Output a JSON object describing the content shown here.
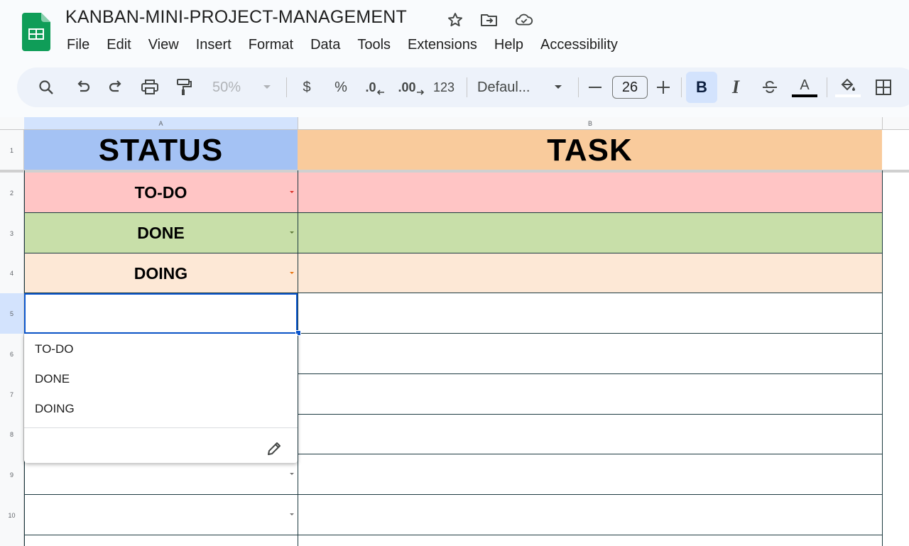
{
  "app": {
    "doc_title": "KANBAN-MINI-PROJECT-MANAGEMENT",
    "icons": [
      "star-icon",
      "move-to-folder-icon",
      "cloud-saved-icon"
    ]
  },
  "menu": [
    "File",
    "Edit",
    "View",
    "Insert",
    "Format",
    "Data",
    "Tools",
    "Extensions",
    "Help",
    "Accessibility"
  ],
  "toolbar": {
    "zoom": "50%",
    "currency": "$",
    "percent": "%",
    "decrease_decimal": ".0",
    "increase_decimal": ".00",
    "number_format": "123",
    "font_family": "Defaul...",
    "font_size": "26",
    "bold": "B",
    "italic": "I",
    "text_color_letter": "A"
  },
  "sheet": {
    "columns": [
      "A",
      "B"
    ],
    "rows": [
      "1",
      "2",
      "3",
      "4",
      "5",
      "6",
      "7",
      "8",
      "9",
      "10"
    ],
    "header": {
      "status": "STATUS",
      "task": "TASK"
    },
    "status_values": [
      "TO-DO",
      "DONE",
      "DOING"
    ],
    "colors": {
      "status_header": "#a4c2f4",
      "task_header": "#f9cb9c",
      "todo_row": "#ffc5c5",
      "done_row": "#c8dfa9",
      "doing_row": "#fde8d6",
      "selection_blue": "#0b57d0"
    }
  },
  "dropdown": {
    "options": [
      "TO-DO",
      "DONE",
      "DOING"
    ]
  }
}
